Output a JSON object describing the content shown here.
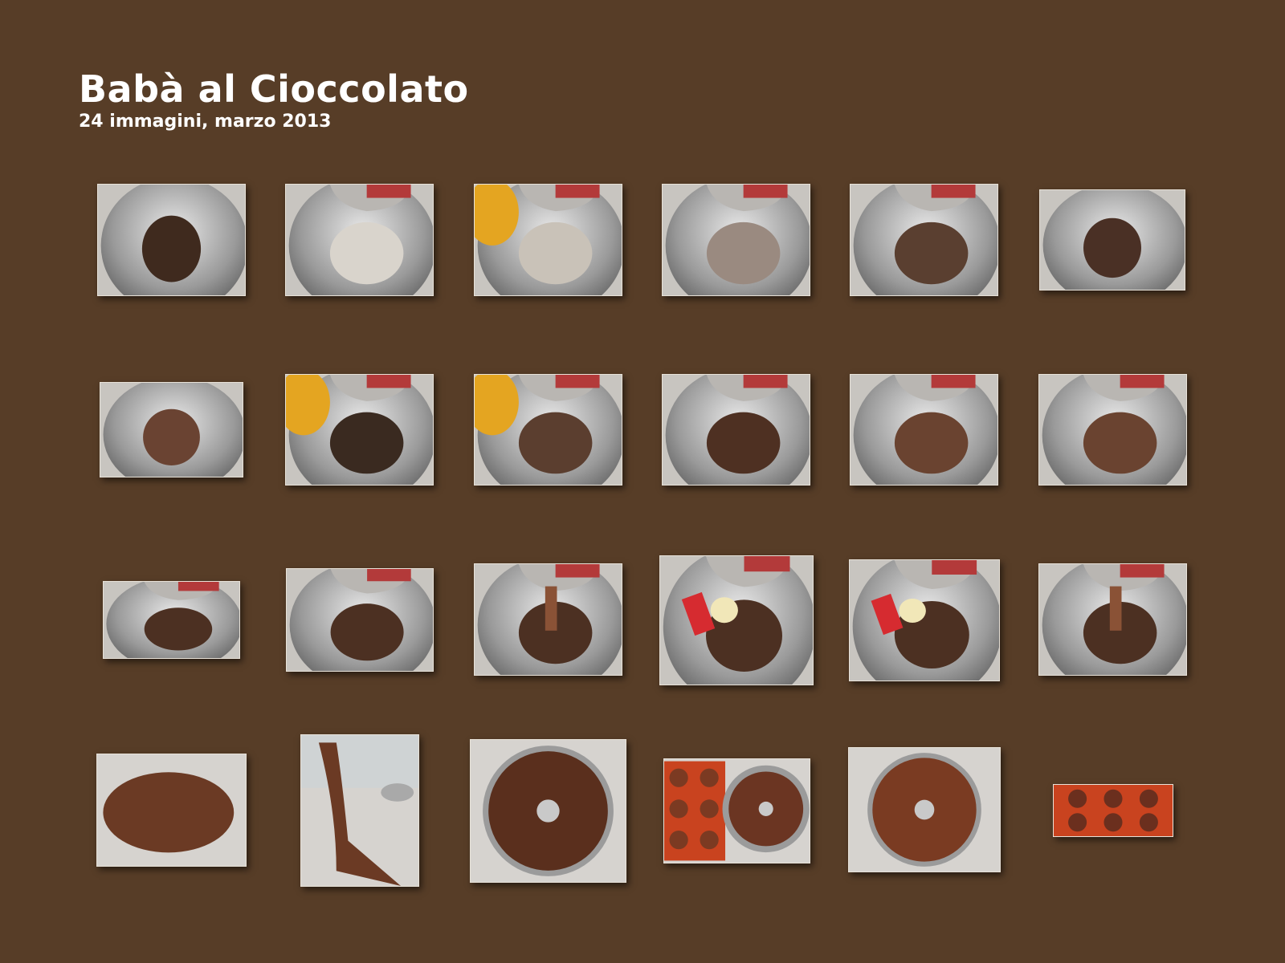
{
  "album": {
    "title": "Babà al Cioccolato",
    "subtitle": "24 immagini, marzo 2013"
  },
  "photos": [
    {
      "scene": "bowl-cocoa-flour"
    },
    {
      "scene": "mixer-flour"
    },
    {
      "scene": "mixer-eggs"
    },
    {
      "scene": "bowl-dough-light"
    },
    {
      "scene": "bowl-dough-dark"
    },
    {
      "scene": "bowl-dough-small"
    },
    {
      "scene": "bowl-dough-ball"
    },
    {
      "scene": "mixer-eggs-pour"
    },
    {
      "scene": "mixer-eggs-pour-2"
    },
    {
      "scene": "mixer-dough"
    },
    {
      "scene": "mixer-dough-2"
    },
    {
      "scene": "mixer-dough-3"
    },
    {
      "scene": "mixer-batter"
    },
    {
      "scene": "mixer-batter-2"
    },
    {
      "scene": "mixer-batter-hook"
    },
    {
      "scene": "mixer-butter-spatula"
    },
    {
      "scene": "mixer-butter-spatula-2"
    },
    {
      "scene": "mixer-batter-smooth"
    },
    {
      "scene": "dough-on-marble"
    },
    {
      "scene": "dough-stretch"
    },
    {
      "scene": "ring-mold-raw"
    },
    {
      "scene": "molds-filled"
    },
    {
      "scene": "ring-cake-baked"
    },
    {
      "scene": "silicone-mold-baked"
    }
  ]
}
